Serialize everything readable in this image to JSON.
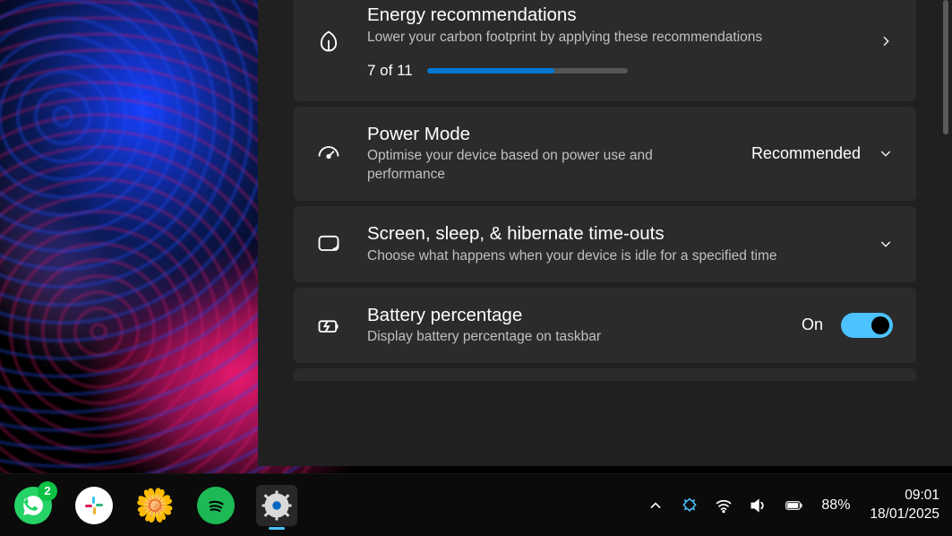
{
  "settings": {
    "cards": {
      "energy": {
        "title": "Energy recommendations",
        "sub": "Lower your carbon footprint by applying these recommendations",
        "progress_text": "7 of 11",
        "progress_percent": 63.6
      },
      "power_mode": {
        "title": "Power Mode",
        "sub": "Optimise your device based on power use and performance",
        "value": "Recommended"
      },
      "timeouts": {
        "title": "Screen, sleep, & hibernate time-outs",
        "sub": "Choose what happens when your device is idle for a specified time"
      },
      "battery_pct": {
        "title": "Battery percentage",
        "sub": "Display battery percentage on taskbar",
        "state_label": "On"
      }
    }
  },
  "taskbar": {
    "whatsapp_badge": "2",
    "battery_pct": "88%",
    "time": "09:01",
    "date": "18/01/2025"
  }
}
